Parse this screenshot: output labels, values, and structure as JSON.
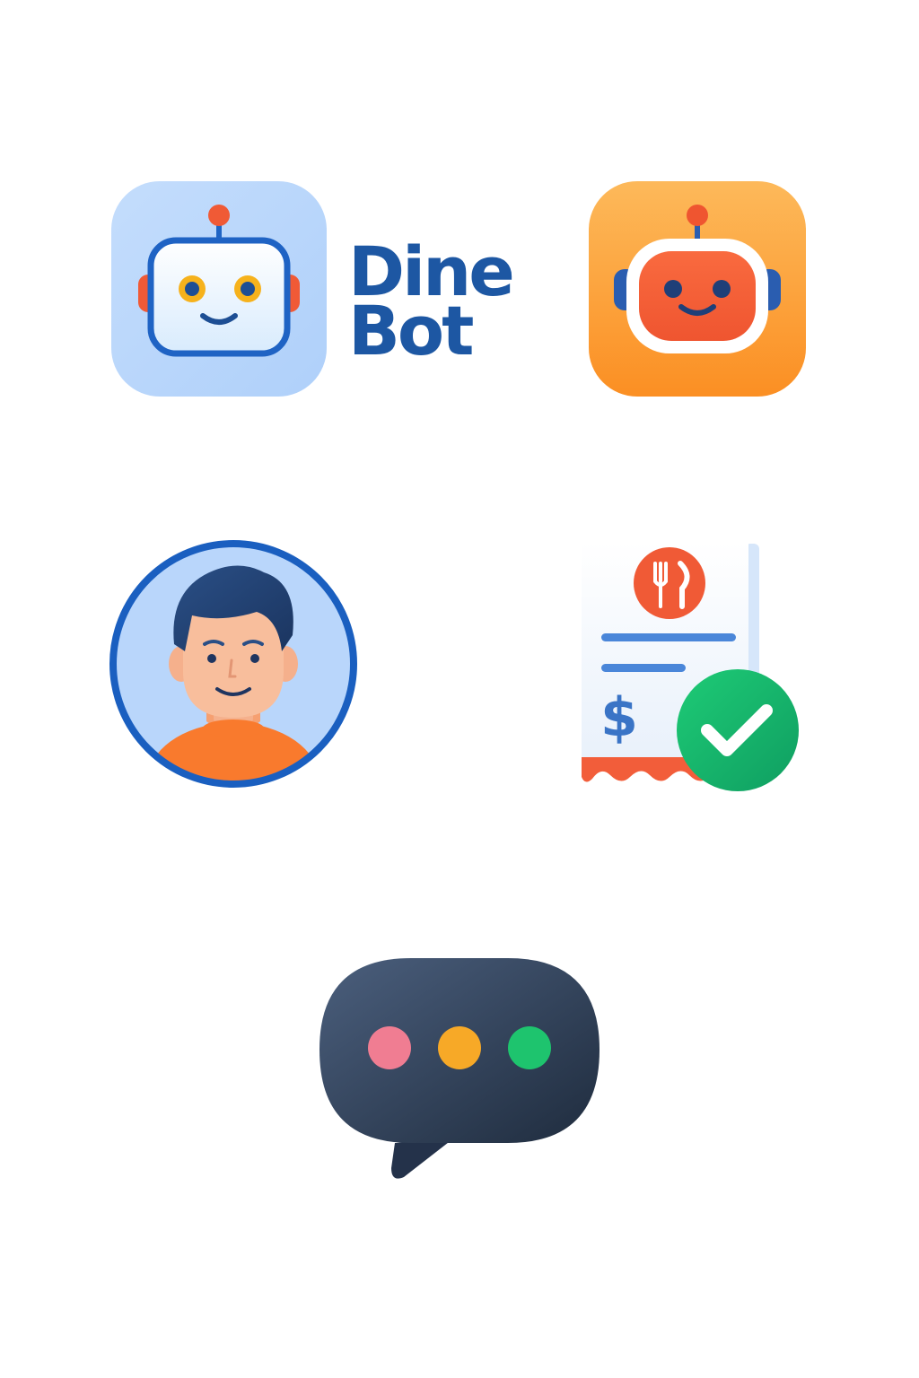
{
  "brand": {
    "name_line1": "Dine",
    "name_line2": "Bot",
    "colors": {
      "wordmark": "#1d57a3",
      "light_tile": "#b9d6fb",
      "orange_tile": "#fb9e2f",
      "robot_accent": "#f05a36",
      "success_green": "#18b26a",
      "dark_bubble": "#2c3a4f"
    }
  },
  "icons": [
    "robot-light-app-icon",
    "robot-orange-app-icon",
    "user-avatar-icon",
    "receipt-paid-icon",
    "typing-indicator-icon"
  ],
  "receipt": {
    "currency_symbol": "$"
  }
}
